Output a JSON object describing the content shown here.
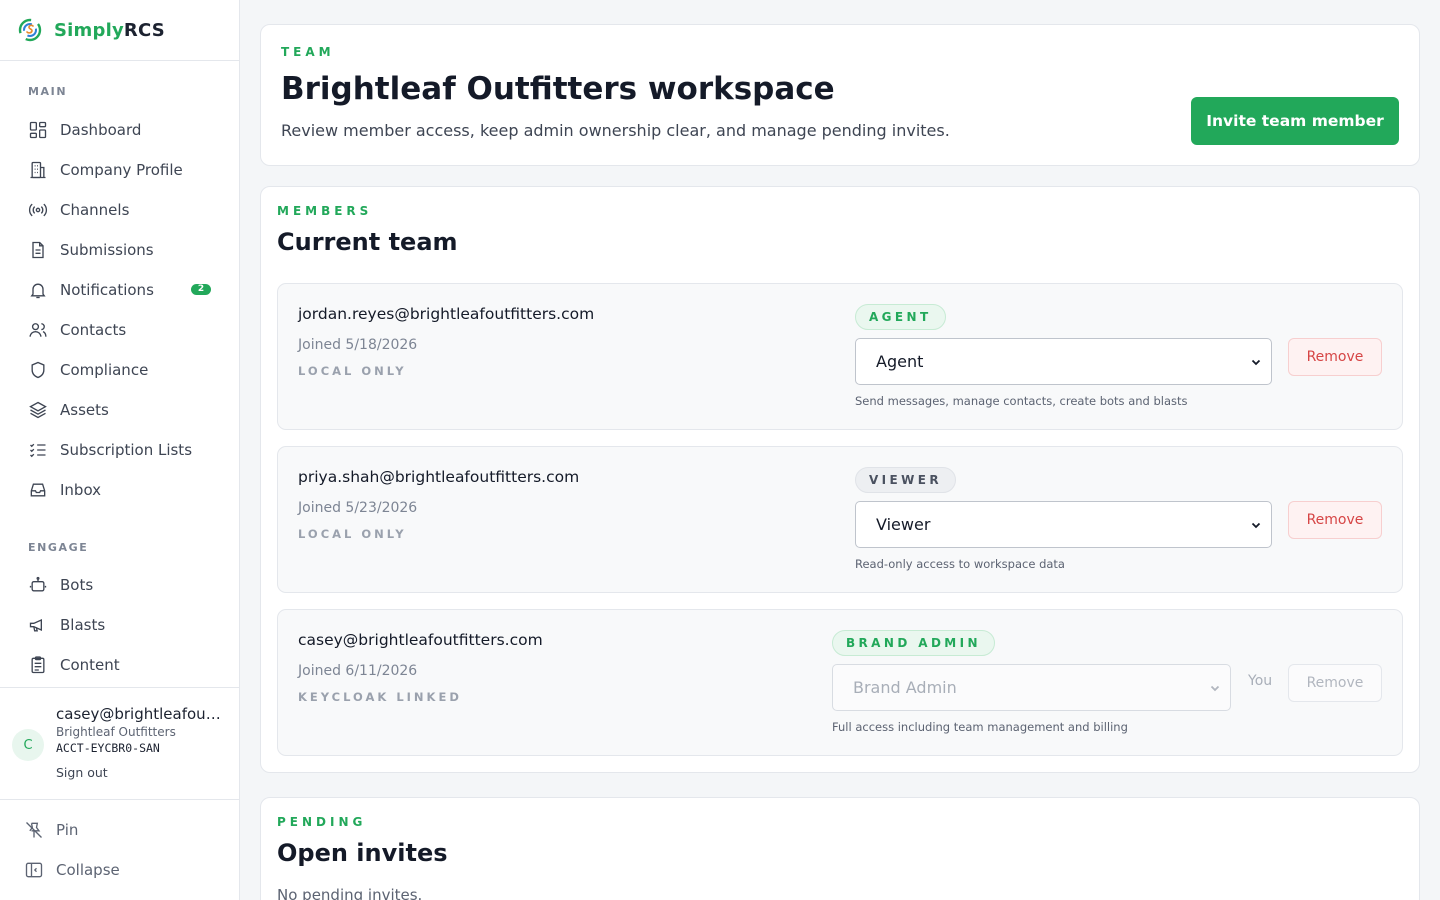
{
  "brand": {
    "name_part1": "Simply",
    "name_part2": "RCS"
  },
  "sidebar": {
    "main_label": "MAIN",
    "main_items": [
      {
        "label": "Dashboard",
        "icon": "dashboard-icon"
      },
      {
        "label": "Company Profile",
        "icon": "building-icon"
      },
      {
        "label": "Channels",
        "icon": "broadcast-icon"
      },
      {
        "label": "Submissions",
        "icon": "document-icon"
      },
      {
        "label": "Notifications",
        "icon": "bell-icon",
        "badge": "2"
      },
      {
        "label": "Contacts",
        "icon": "users-icon"
      },
      {
        "label": "Compliance",
        "icon": "shield-icon"
      },
      {
        "label": "Assets",
        "icon": "layers-icon"
      },
      {
        "label": "Subscription Lists",
        "icon": "list-check-icon"
      },
      {
        "label": "Inbox",
        "icon": "inbox-icon"
      }
    ],
    "engage_label": "ENGAGE",
    "engage_items": [
      {
        "label": "Bots",
        "icon": "robot-icon"
      },
      {
        "label": "Blasts",
        "icon": "megaphone-icon"
      },
      {
        "label": "Content",
        "icon": "clipboard-icon"
      }
    ],
    "user": {
      "initial": "C",
      "email": "casey@brightleafoutfitters.com",
      "company": "Brightleaf Outfitters",
      "account_id": "ACCT-EYCBR0-SAN",
      "signout_label": "Sign out"
    },
    "footer": {
      "pin_label": "Pin",
      "collapse_label": "Collapse"
    }
  },
  "header": {
    "eyebrow": "TEAM",
    "title": "Brightleaf Outfitters workspace",
    "subtitle": "Review member access, keep admin ownership clear, and manage pending invites.",
    "invite_button": "Invite team member"
  },
  "members_section": {
    "eyebrow": "MEMBERS",
    "title": "Current team",
    "members": [
      {
        "email": "jordan.reyes@brightleafoutfitters.com",
        "joined": "Joined 5/18/2026",
        "source": "LOCAL ONLY",
        "badge": "AGENT",
        "role": "Agent",
        "role_desc": "Send messages, manage contacts, create bots and blasts",
        "remove_label": "Remove"
      },
      {
        "email": "priya.shah@brightleafoutfitters.com",
        "joined": "Joined 5/23/2026",
        "source": "LOCAL ONLY",
        "badge": "VIEWER",
        "role": "Viewer",
        "role_desc": "Read-only access to workspace data",
        "remove_label": "Remove"
      },
      {
        "email": "casey@brightleafoutfitters.com",
        "joined": "Joined 6/11/2026",
        "source": "KEYCLOAK LINKED",
        "badge": "BRAND ADMIN",
        "role": "Brand Admin",
        "role_desc": "Full access including team management and billing",
        "you_label": "You",
        "remove_label": "Remove"
      }
    ]
  },
  "pending_section": {
    "eyebrow": "PENDING",
    "title": "Open invites",
    "empty_text": "No pending invites."
  }
}
